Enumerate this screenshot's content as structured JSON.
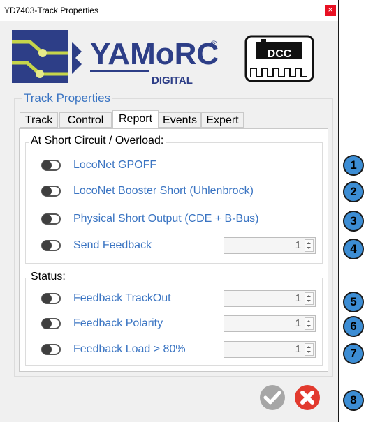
{
  "window": {
    "title": "YD7403-Track Properties",
    "close_glyph": "×"
  },
  "logo": {
    "brand": "YAMoRC",
    "registered": "®",
    "subtitle": "DIGITAL",
    "badge_text": "DCC"
  },
  "group": {
    "title": "Track Properties"
  },
  "tabs": [
    {
      "label": "Track",
      "active": false
    },
    {
      "label": "Control",
      "active": false
    },
    {
      "label": "Report",
      "active": true
    },
    {
      "label": "Events",
      "active": false
    },
    {
      "label": "Expert",
      "active": false
    }
  ],
  "short_circuit": {
    "title": "At Short Circuit / Overload:",
    "options": [
      {
        "label": "LocoNet GPOFF",
        "enabled": false
      },
      {
        "label": "LocoNet Booster Short (Uhlenbrock)",
        "enabled": false
      },
      {
        "label": "Physical Short Output (CDE + B-Bus)",
        "enabled": false
      },
      {
        "label": "Send Feedback",
        "enabled": false,
        "value": "1"
      }
    ]
  },
  "status": {
    "title": "Status:",
    "options": [
      {
        "label": "Feedback TrackOut",
        "enabled": false,
        "value": "1"
      },
      {
        "label": "Feedback Polarity",
        "enabled": false,
        "value": "1"
      },
      {
        "label": "Feedback Load > 80%",
        "enabled": false,
        "value": "1"
      }
    ]
  },
  "buttons": {
    "ok_icon": "checkmark-icon",
    "cancel_icon": "cancel-icon"
  },
  "callouts": [
    "1",
    "2",
    "3",
    "4",
    "5",
    "6",
    "7",
    "8"
  ],
  "colors": {
    "label_blue": "#3a74c2",
    "callout_blue": "#3c8dd4",
    "cancel_red": "#e23a2e",
    "ok_gray": "#a6a6a6",
    "logo_blue": "#2d3e87"
  }
}
